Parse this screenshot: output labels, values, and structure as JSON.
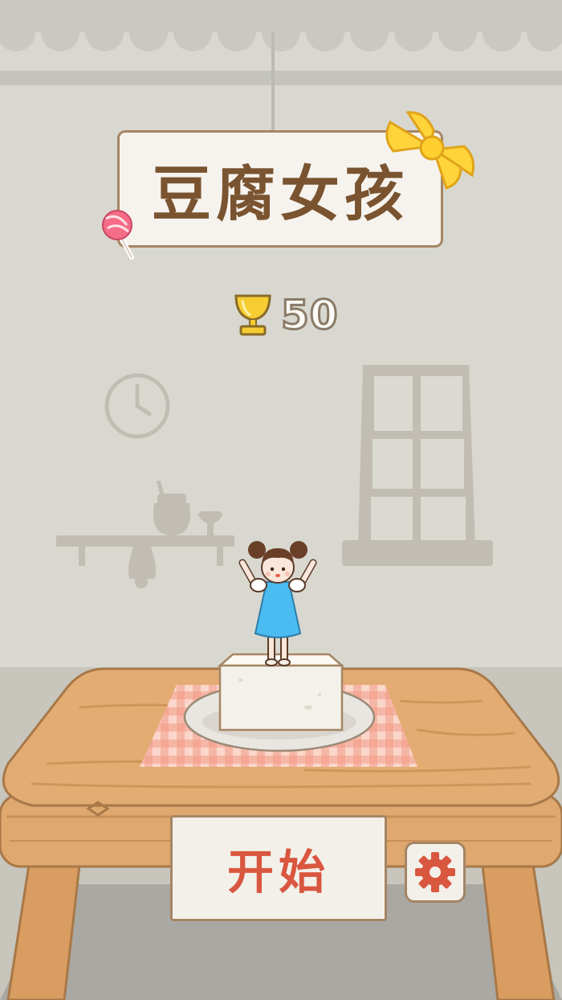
{
  "game": {
    "title": "豆腐女孩",
    "best_score": "50",
    "start_label": "开始"
  },
  "icons": {
    "trophy": "trophy-icon",
    "settings": "gear-icon",
    "lollipop": "lollipop-icon",
    "bow": "bow-icon",
    "clock": "clock-icon"
  },
  "colors": {
    "wall": "#d8d8d0",
    "title_text": "#7a5430",
    "start_text": "#d9573f",
    "table": "#dfa86f",
    "dress": "#4bbcf2",
    "trophy": "#f0c52c"
  }
}
